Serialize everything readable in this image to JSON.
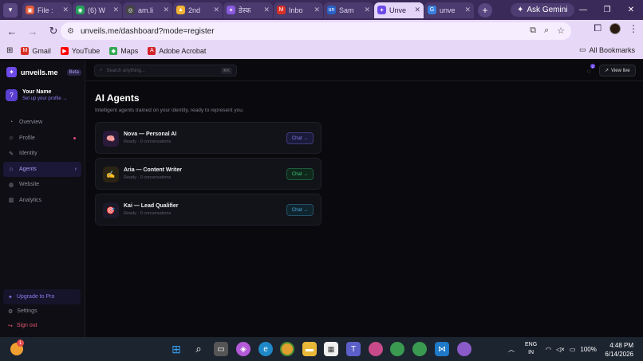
{
  "browser": {
    "tabs": [
      {
        "title": "File :",
        "color": "#e05a3a",
        "glyph": "▣"
      },
      {
        "title": "(6) W",
        "color": "#25a05a",
        "glyph": "◉"
      },
      {
        "title": "am.li",
        "color": "#444444",
        "glyph": "◎"
      },
      {
        "title": "2nd",
        "color": "#f2b233",
        "glyph": "▲"
      },
      {
        "title": "डेस्क",
        "color": "#8a5ae0",
        "glyph": "✦"
      },
      {
        "title": "Inbo",
        "color": "#d93025",
        "glyph": "M"
      },
      {
        "title": "Sam",
        "color": "#2a62c8",
        "glyph": "un"
      },
      {
        "title": "Unve",
        "color": "#6d4ae8",
        "glyph": "✦"
      },
      {
        "title": "unve",
        "color": "#3a80e0",
        "glyph": "G"
      }
    ],
    "ask_gemini": "Ask Gemini",
    "url": "unveils.me/dashboard?mode=register",
    "bookmarks": [
      {
        "label": "Gmail",
        "color": "#d93025",
        "glyph": "M"
      },
      {
        "label": "YouTube",
        "color": "#ff0000",
        "glyph": "▶"
      },
      {
        "label": "Maps",
        "color": "#34a853",
        "glyph": "◆"
      },
      {
        "label": "Adobe Acrobat",
        "color": "#d3232a",
        "glyph": "A"
      }
    ],
    "all_bookmarks": "All Bookmarks"
  },
  "app": {
    "brand": "unveils.me",
    "beta": "Beta",
    "user": {
      "initial": "?",
      "name": "Your Name",
      "link": "Set up your profile →"
    },
    "nav": [
      {
        "label": "Overview",
        "icon": "◔"
      },
      {
        "label": "Profile",
        "icon": "☺"
      },
      {
        "label": "Identity",
        "icon": "✎"
      },
      {
        "label": "Agents",
        "icon": "⌂"
      },
      {
        "label": "Website",
        "icon": "◍"
      },
      {
        "label": "Analytics",
        "icon": "▥"
      }
    ],
    "upgrade": "Upgrade to Pro",
    "settings": "Settings",
    "signout": "Sign out",
    "search_placeholder": "Search anything...",
    "search_kbd": "⌘K",
    "bell_count": "2",
    "view_live": "View live",
    "page_title": "AI Agents",
    "page_subtitle": "Intelligent agents trained on your identity, ready to represent you.",
    "chat_label": "Chat →",
    "agents": [
      {
        "name": "Nova — Personal AI",
        "meta": "Ready · 0 conversations",
        "icon": "🧠",
        "icon_bg": "#2a1a3a",
        "chat_bg": "#1a1a3a",
        "chat_fg": "#8b7cf0"
      },
      {
        "name": "Aria — Content Writer",
        "meta": "Ready · 0 conversations",
        "icon": "✍",
        "icon_bg": "#2a2414",
        "chat_bg": "#10281c",
        "chat_fg": "#39c47a"
      },
      {
        "name": "Kai — Lead Qualifier",
        "meta": "Ready · 0 conversations",
        "icon": "🎯",
        "icon_bg": "#1a1a2a",
        "chat_bg": "#10242e",
        "chat_fg": "#4aa8d8"
      }
    ]
  },
  "taskbar": {
    "weather_badge": "1",
    "lang_top": "ENG",
    "lang_bottom": "IN",
    "battery": "100%",
    "time": "4:48 PM",
    "date": "6/14/2026"
  }
}
